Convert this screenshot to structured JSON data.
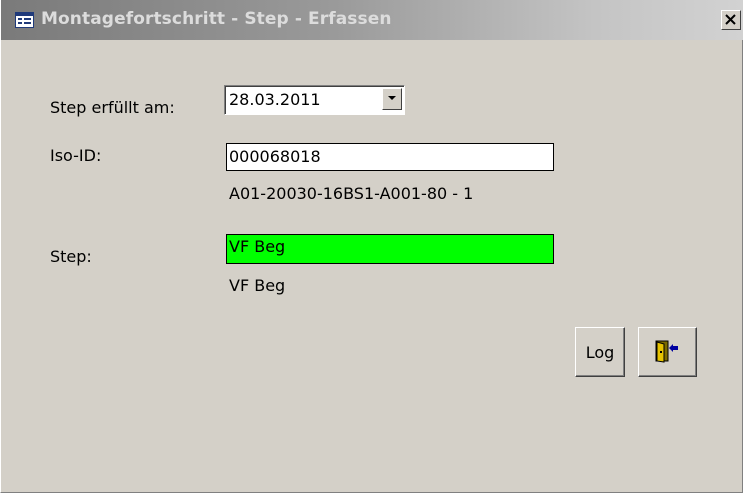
{
  "window": {
    "title": "Montagefortschritt - Step - Erfassen"
  },
  "form": {
    "date_label": "Step erfüllt am:",
    "date_value": "28.03.2011",
    "iso_label": "Iso-ID:",
    "iso_value": "000068018",
    "iso_description": "A01-20030-16BS1-A001-80 - 1",
    "step_label": "Step:",
    "step_value": "VF Beg",
    "step_description": "VF Beg"
  },
  "buttons": {
    "log_label": "Log",
    "exit_icon": "exit-door-icon"
  },
  "colors": {
    "step_highlight": "#00ff00",
    "background": "#d4d0c8"
  }
}
